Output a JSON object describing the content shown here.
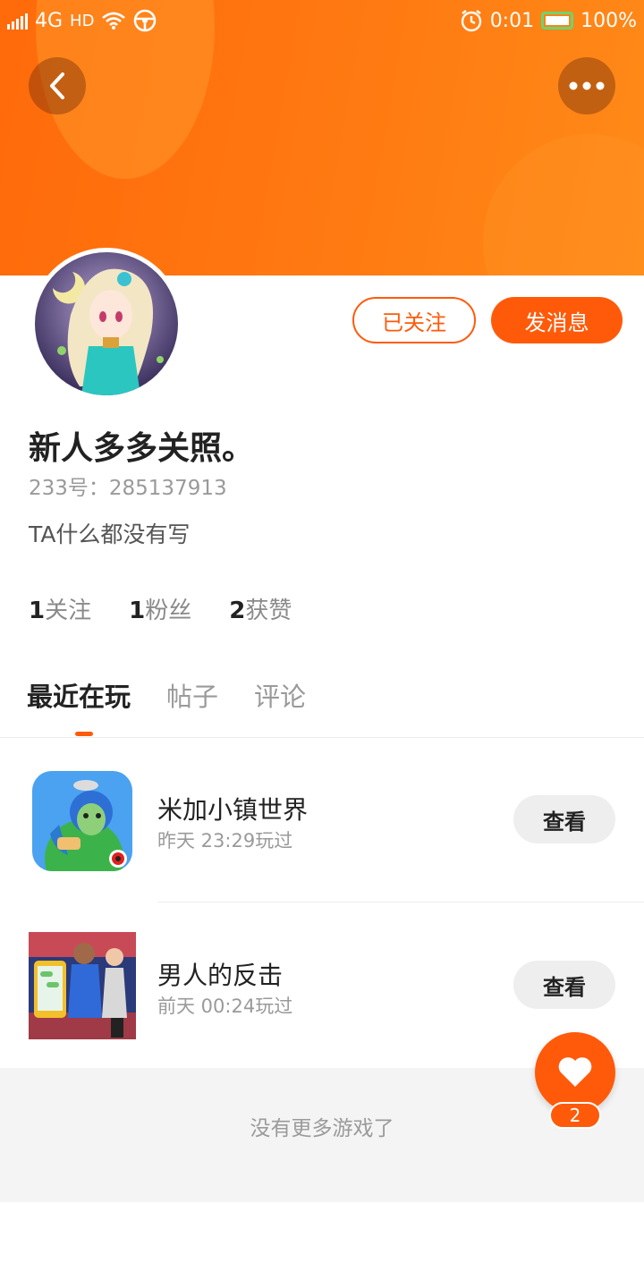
{
  "status_bar": {
    "network": "4G",
    "hd": "HD",
    "time": "0:01",
    "battery": "100%"
  },
  "profile": {
    "username": "新人多多关照。",
    "id_line": "233号：285137913",
    "bio": "TA什么都没有写",
    "follow_button": "已关注",
    "message_button": "发消息"
  },
  "stats": [
    {
      "value": "1",
      "label": "关注"
    },
    {
      "value": "1",
      "label": "粉丝"
    },
    {
      "value": "2",
      "label": "获赞"
    }
  ],
  "tabs": [
    {
      "label": "最近在玩",
      "active": true
    },
    {
      "label": "帖子",
      "active": false
    },
    {
      "label": "评论",
      "active": false
    }
  ],
  "games": [
    {
      "title": "米加小镇世界",
      "played": "昨天 23:29玩过",
      "button": "查看",
      "icon": "toca-world-icon"
    },
    {
      "title": "男人的反击",
      "played": "前天 00:24玩过",
      "button": "查看",
      "icon": "mans-strikeback-icon"
    }
  ],
  "footer": {
    "text": "没有更多游戏了"
  },
  "fab": {
    "icon": "heart-icon",
    "count": "2"
  },
  "colors": {
    "accent": "#ff5a0a",
    "header": "#ff7a12"
  }
}
